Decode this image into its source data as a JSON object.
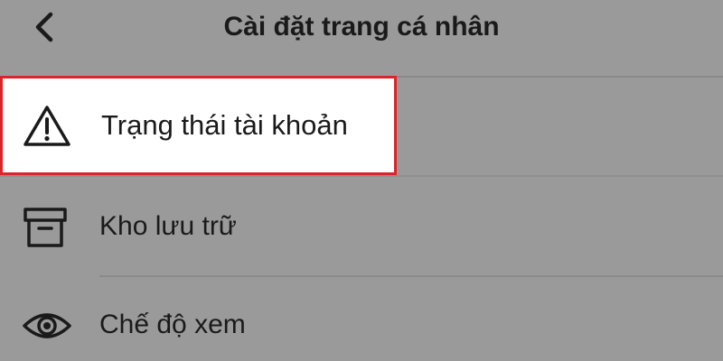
{
  "header": {
    "title": "Cài đặt trang cá nhân",
    "back_icon": "chevron-left-icon"
  },
  "menu": {
    "items": [
      {
        "label": "Trạng thái tài khoản",
        "icon": "warning-triangle-icon",
        "highlighted": true
      },
      {
        "label": "Kho lưu trữ",
        "icon": "archive-box-icon",
        "highlighted": false
      },
      {
        "label": "Chế độ xem",
        "icon": "eye-icon",
        "highlighted": false
      }
    ]
  },
  "colors": {
    "background": "#9a9a9a",
    "highlight_bg": "#ffffff",
    "highlight_border": "#d9262b",
    "text": "#1a1a1a"
  }
}
